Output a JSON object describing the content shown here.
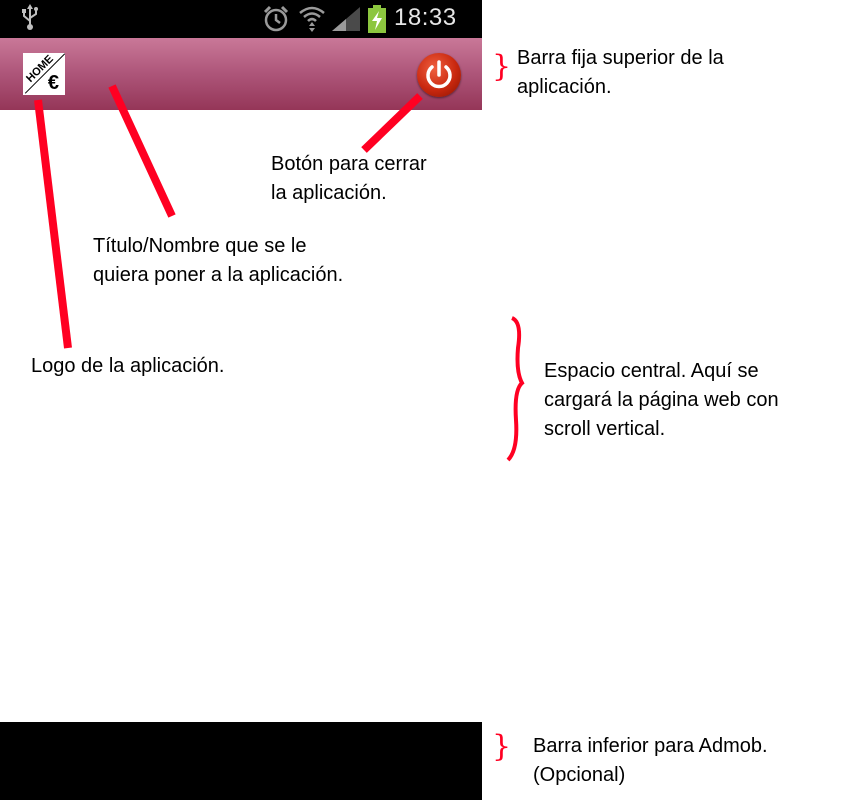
{
  "status_bar": {
    "time": "18:33",
    "icons": [
      "usb-icon",
      "alarm-icon",
      "wifi-icon",
      "signal-icon",
      "battery-charging-icon"
    ]
  },
  "app_bar": {
    "logo": {
      "text": "HOME",
      "symbol": "€"
    },
    "close_button_icon": "power-icon"
  },
  "annotations": {
    "top_bar": [
      "Barra fija superior de la",
      "aplicación."
    ],
    "close_button": [
      "Botón para cerrar",
      "la aplicación."
    ],
    "title": [
      "Título/Nombre que se le",
      "quiera poner a la aplicación."
    ],
    "logo": [
      "Logo de la aplicación."
    ],
    "central_space": [
      "Espacio central. Aquí se",
      "cargará la página web con",
      "scroll vertical."
    ],
    "admob_bar": [
      "Barra inferior para Admob.",
      "(Opcional)"
    ]
  },
  "colors": {
    "app_bar_top": "#c97898",
    "app_bar_bottom": "#953658",
    "annotation_accent": "#ff0022",
    "power_button": "#c9280f"
  }
}
